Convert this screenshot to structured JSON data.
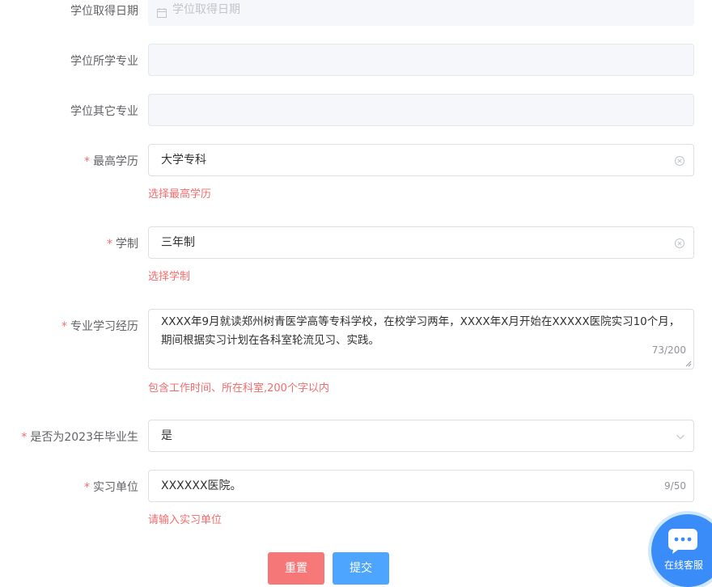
{
  "fields": {
    "degree_date": {
      "label": "学位取得日期",
      "placeholder": "学位取得日期"
    },
    "degree_major": {
      "label": "学位所学专业",
      "value": ""
    },
    "degree_other_major": {
      "label": "学位其它专业",
      "value": ""
    },
    "highest_edu": {
      "label": "最高学历",
      "value": "大学专科",
      "error": "选择最高学历"
    },
    "school_system": {
      "label": "学制",
      "value": "三年制",
      "error": "选择学制"
    },
    "study_experience": {
      "label": "专业学习经历",
      "value": "XXXX年9月就读郑州树青医学高等专科学校，在校学习两年，XXXX年X月开始在XXXXX医院实习10个月，期间根据实习计划在各科室轮流见习、实践。",
      "counter": "73/200",
      "error": "包含工作时间、所在科室,200个字以内"
    },
    "graduate_2023": {
      "label": "是否为2023年毕业生",
      "value": "是"
    },
    "internship_unit": {
      "label": "实习单位",
      "value": "XXXXXX医院。",
      "counter": "9/50",
      "error": "请输入实习单位"
    }
  },
  "required_mark": "*",
  "buttons": {
    "reset": "重置",
    "submit": "提交"
  },
  "customer_service": {
    "label": "在线客服"
  },
  "colors": {
    "error": "#f56c6c",
    "primary": "#409eff",
    "disabled_bg": "#f5f7fa"
  }
}
